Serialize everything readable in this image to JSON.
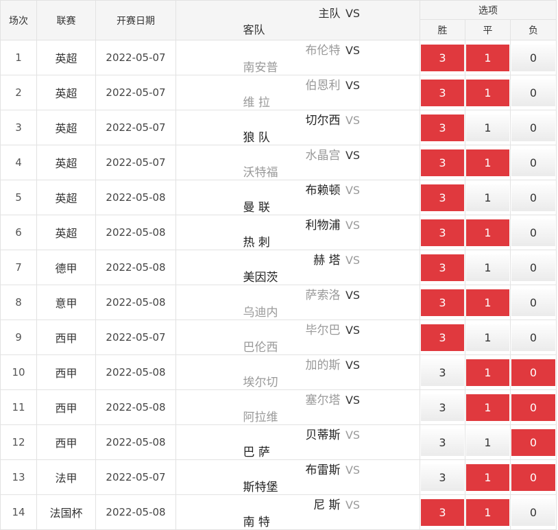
{
  "header": {
    "idx": "场次",
    "league": "联赛",
    "date": "开赛日期",
    "home": "主队",
    "vs": "VS",
    "away": "客队",
    "options": "选项",
    "win": "胜",
    "draw": "平",
    "lose": "负"
  },
  "colors": {
    "selected": "#e0393e",
    "highlight_team": "#222222",
    "muted_team": "#999999"
  },
  "rows": [
    {
      "idx": "1",
      "league": "英超",
      "date": "2022-05-07",
      "home": "布伦特",
      "vs": "VS",
      "away": "南安普",
      "highlight": "none",
      "win": "3",
      "draw": "1",
      "lose": "0",
      "sel": [
        true,
        true,
        false
      ]
    },
    {
      "idx": "2",
      "league": "英超",
      "date": "2022-05-07",
      "home": "伯恩利",
      "vs": "VS",
      "away": "维 拉",
      "highlight": "none",
      "win": "3",
      "draw": "1",
      "lose": "0",
      "sel": [
        true,
        true,
        false
      ]
    },
    {
      "idx": "3",
      "league": "英超",
      "date": "2022-05-07",
      "home": "切尔西",
      "vs": "VS",
      "away": "狼 队",
      "highlight": "both",
      "win": "3",
      "draw": "1",
      "lose": "0",
      "sel": [
        true,
        false,
        false
      ]
    },
    {
      "idx": "4",
      "league": "英超",
      "date": "2022-05-07",
      "home": "水晶宫",
      "vs": "VS",
      "away": "沃特福",
      "highlight": "none",
      "win": "3",
      "draw": "1",
      "lose": "0",
      "sel": [
        true,
        true,
        false
      ]
    },
    {
      "idx": "5",
      "league": "英超",
      "date": "2022-05-08",
      "home": "布赖顿",
      "vs": "VS",
      "away": "曼 联",
      "highlight": "both",
      "win": "3",
      "draw": "1",
      "lose": "0",
      "sel": [
        true,
        false,
        false
      ]
    },
    {
      "idx": "6",
      "league": "英超",
      "date": "2022-05-08",
      "home": "利物浦",
      "vs": "VS",
      "away": "热 刺",
      "highlight": "both",
      "win": "3",
      "draw": "1",
      "lose": "0",
      "sel": [
        true,
        true,
        false
      ]
    },
    {
      "idx": "7",
      "league": "德甲",
      "date": "2022-05-08",
      "home": "赫 塔",
      "vs": "VS",
      "away": "美因茨",
      "highlight": "both",
      "win": "3",
      "draw": "1",
      "lose": "0",
      "sel": [
        true,
        false,
        false
      ]
    },
    {
      "idx": "8",
      "league": "意甲",
      "date": "2022-05-08",
      "home": "萨索洛",
      "vs": "VS",
      "away": "乌迪内",
      "highlight": "none",
      "win": "3",
      "draw": "1",
      "lose": "0",
      "sel": [
        true,
        true,
        false
      ]
    },
    {
      "idx": "9",
      "league": "西甲",
      "date": "2022-05-07",
      "home": "毕尔巴",
      "vs": "VS",
      "away": "巴伦西",
      "highlight": "none",
      "win": "3",
      "draw": "1",
      "lose": "0",
      "sel": [
        true,
        false,
        false
      ]
    },
    {
      "idx": "10",
      "league": "西甲",
      "date": "2022-05-08",
      "home": "加的斯",
      "vs": "VS",
      "away": "埃尔切",
      "highlight": "none",
      "win": "3",
      "draw": "1",
      "lose": "0",
      "sel": [
        false,
        true,
        true
      ]
    },
    {
      "idx": "11",
      "league": "西甲",
      "date": "2022-05-08",
      "home": "塞尔塔",
      "vs": "VS",
      "away": "阿拉维",
      "highlight": "none",
      "win": "3",
      "draw": "1",
      "lose": "0",
      "sel": [
        false,
        true,
        true
      ]
    },
    {
      "idx": "12",
      "league": "西甲",
      "date": "2022-05-08",
      "home": "贝蒂斯",
      "vs": "VS",
      "away": "巴 萨",
      "highlight": "both",
      "win": "3",
      "draw": "1",
      "lose": "0",
      "sel": [
        false,
        false,
        true
      ]
    },
    {
      "idx": "13",
      "league": "法甲",
      "date": "2022-05-07",
      "home": "布雷斯",
      "vs": "VS",
      "away": "斯特堡",
      "highlight": "both",
      "win": "3",
      "draw": "1",
      "lose": "0",
      "sel": [
        false,
        true,
        true
      ]
    },
    {
      "idx": "14",
      "league": "法国杯",
      "date": "2022-05-08",
      "home": "尼 斯",
      "vs": "VS",
      "away": "南 特",
      "highlight": "both",
      "win": "3",
      "draw": "1",
      "lose": "0",
      "sel": [
        true,
        true,
        false
      ]
    }
  ]
}
